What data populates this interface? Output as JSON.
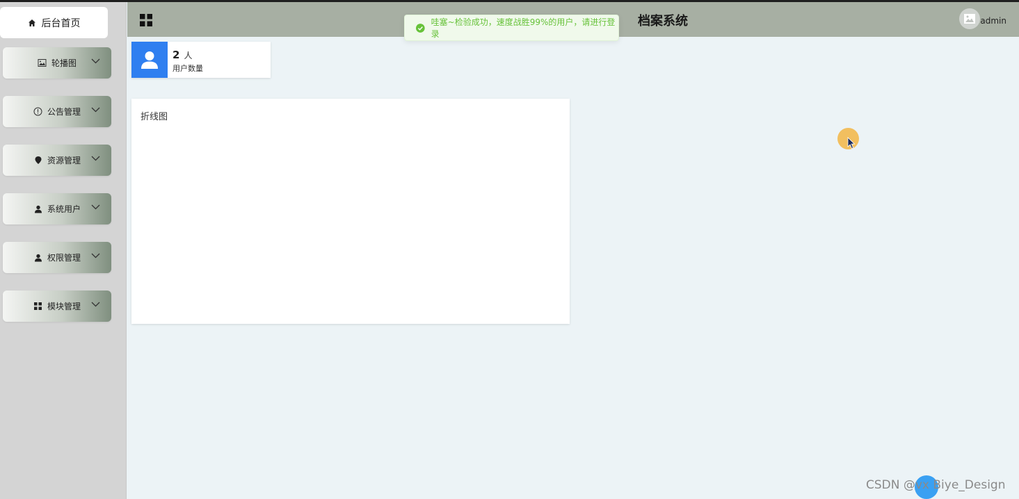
{
  "header": {
    "title": "档案系统",
    "user_name": "admin"
  },
  "sidebar": {
    "home_label": "后台首页",
    "items": [
      {
        "label": "轮播图",
        "icon": "image-icon"
      },
      {
        "label": "公告管理",
        "icon": "info-circle-icon"
      },
      {
        "label": "资源管理",
        "icon": "location-pin-icon"
      },
      {
        "label": "系统用户",
        "icon": "user-icon"
      },
      {
        "label": "权限管理",
        "icon": "user-icon"
      },
      {
        "label": "模块管理",
        "icon": "grid-icon"
      }
    ]
  },
  "toast": {
    "message": "哇塞~检验成功，速度战胜99%的用户，请进行登录",
    "color": "#67c23a"
  },
  "stats": {
    "value": "2",
    "unit": "人",
    "label": "用户数量"
  },
  "chart": {
    "title": "折线图"
  },
  "watermark": {
    "text": "CSDN @vx Biye_Design"
  },
  "colors": {
    "accent": "#2f7ff0",
    "header_bg": "#a7afa3",
    "sidebar_bg": "#d4d4d4"
  }
}
